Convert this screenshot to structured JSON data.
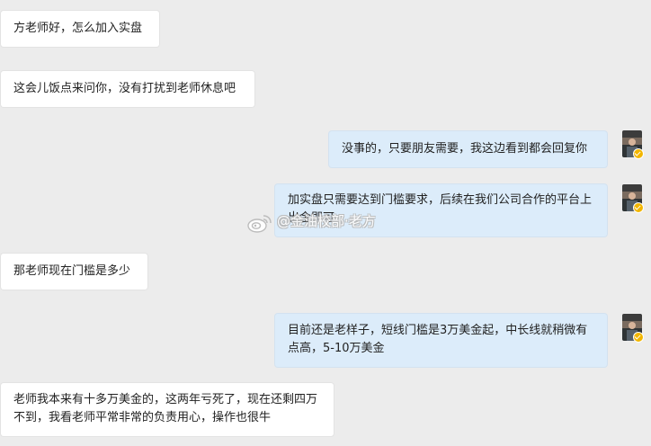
{
  "messages": [
    {
      "side": "left",
      "text": "方老师好，怎么加入实盘"
    },
    {
      "side": "left",
      "text": "这会儿饭点来问你，没有打扰到老师休息吧"
    },
    {
      "side": "right",
      "text": "没事的，只要朋友需要，我这边看到都会回复你"
    },
    {
      "side": "right",
      "text": "加实盘只需要达到门槛要求，后续在我们公司合作的平台上出金即可"
    },
    {
      "side": "left",
      "text": "那老师现在门槛是多少"
    },
    {
      "side": "right",
      "text": "目前还是老样子，短线门槛是3万美金起，中长线就稍微有点高，5-10万美金"
    },
    {
      "side": "left",
      "text": "老师我本来有十多万美金的，这两年亏死了，现在还剩四万不到，我看老师平常非常的负责用心，操作也很牛"
    }
  ],
  "watermark": {
    "text": "@金油校部·老方",
    "logo_icon": "weibo-logo-icon"
  },
  "colors": {
    "background": "#ececec",
    "incoming_bubble": "#ffffff",
    "outgoing_bubble": "#dcecfa",
    "verified_badge": "#f2b600"
  }
}
